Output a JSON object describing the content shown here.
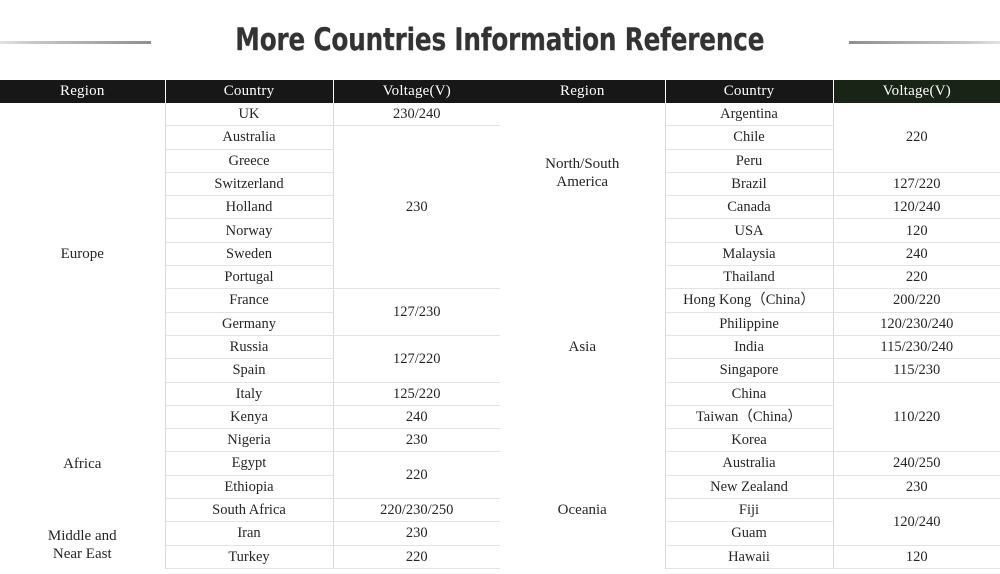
{
  "page": {
    "title": "More Countries Information Reference",
    "accent_dark": "#171717",
    "accent_green": "#1a2416",
    "title_color": "#333333"
  },
  "decorations": {
    "left_rule": "horizontal-rule-left",
    "right_rule": "horizontal-rule-right"
  },
  "columns": {
    "region": "Region",
    "country": "Country",
    "voltage": "Voltage(V)"
  },
  "left_table": {
    "regions": [
      {
        "name": "Europe",
        "rows": 13,
        "shade": "#f5f5f5"
      },
      {
        "name": "Africa",
        "rows": 5,
        "shade": "#e8e8e8"
      },
      {
        "name": "Middle and\nNear East",
        "rows": 2,
        "shade": "#d4d4d4"
      }
    ],
    "countries": [
      "UK",
      "Australia",
      "Greece",
      "Switzerland",
      "Holland",
      "Norway",
      "Sweden",
      "Portugal",
      "France",
      "Germany",
      "Russia",
      "Spain",
      "Italy",
      "Kenya",
      "Nigeria",
      "Egypt",
      "Ethiopia",
      "South Africa",
      "Iran",
      "Turkey"
    ],
    "voltages": [
      {
        "value": "230/240",
        "span": 1
      },
      {
        "value": "230",
        "span": 7
      },
      {
        "value": "127/230",
        "span": 2
      },
      {
        "value": "127/220",
        "span": 2
      },
      {
        "value": "125/220",
        "span": 1
      },
      {
        "value": "240",
        "span": 1
      },
      {
        "value": "230",
        "span": 1
      },
      {
        "value": "220",
        "span": 2
      },
      {
        "value": "220/230/250",
        "span": 1
      },
      {
        "value": "230",
        "span": 1
      },
      {
        "value": "220",
        "span": 1
      }
    ]
  },
  "right_table": {
    "regions": [
      {
        "name": "North/South\nAmerica",
        "rows": 6,
        "shade": "#d8d8d8"
      },
      {
        "name": "Asia",
        "rows": 9,
        "shade": "#ebebeb"
      },
      {
        "name": "Oceania",
        "rows": 5,
        "shade": "#efefef"
      }
    ],
    "countries": [
      "Argentina",
      "Chile",
      "Peru",
      "Brazil",
      "Canada",
      "USA",
      "Malaysia",
      "Thailand",
      "Hong Kong（China）",
      "Philippine",
      "India",
      "Singapore",
      "China",
      "Taiwan（China）",
      "Korea",
      "Australia",
      "New Zealand",
      "Fiji",
      "Guam",
      "Hawaii"
    ],
    "voltages": [
      {
        "value": "220",
        "span": 3
      },
      {
        "value": "127/220",
        "span": 1
      },
      {
        "value": "120/240",
        "span": 1
      },
      {
        "value": "120",
        "span": 1
      },
      {
        "value": "240",
        "span": 1
      },
      {
        "value": "220",
        "span": 1
      },
      {
        "value": "200/220",
        "span": 1
      },
      {
        "value": "120/230/240",
        "span": 1
      },
      {
        "value": "115/230/240",
        "span": 1
      },
      {
        "value": "115/230",
        "span": 1
      },
      {
        "value": "110/220",
        "span": 3
      },
      {
        "value": "240/250",
        "span": 1
      },
      {
        "value": "230",
        "span": 1
      },
      {
        "value": "120/240",
        "span": 2
      },
      {
        "value": "120",
        "span": 1
      }
    ]
  }
}
